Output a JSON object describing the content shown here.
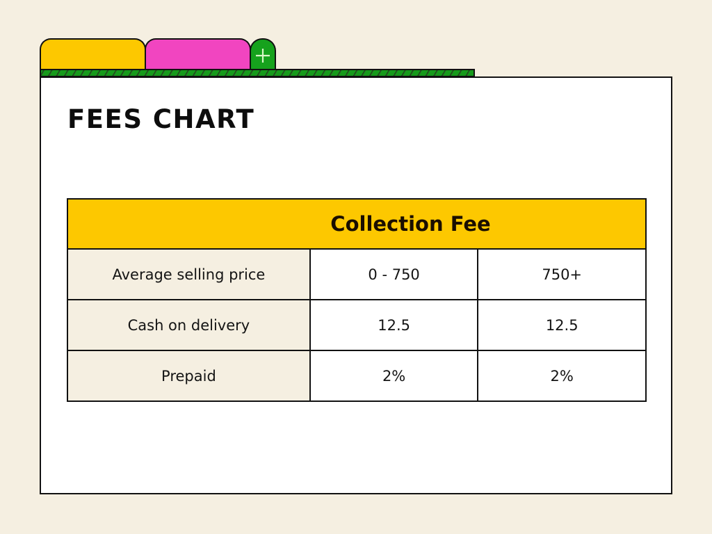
{
  "tabs": [
    {
      "name": "yellow-tab",
      "color": "#fdc800"
    },
    {
      "name": "pink-tab",
      "color": "#f145c0"
    }
  ],
  "add_tab": {
    "icon": "plus-icon",
    "color": "#16a21d"
  },
  "colors": {
    "background": "#f5efe1",
    "accent_yellow": "#fdc800",
    "accent_pink": "#f145c0",
    "accent_green": "#16a21d",
    "panel": "#ffffff",
    "border": "#111111"
  },
  "page": {
    "title": "FEES CHART"
  },
  "table": {
    "header": "Collection Fee",
    "rows": [
      {
        "label": "Average selling price",
        "values": [
          "0 - 750",
          "750+"
        ]
      },
      {
        "label": "Cash on delivery",
        "values": [
          "12.5",
          "12.5"
        ]
      },
      {
        "label": "Prepaid",
        "values": [
          "2%",
          "2%"
        ]
      }
    ]
  }
}
